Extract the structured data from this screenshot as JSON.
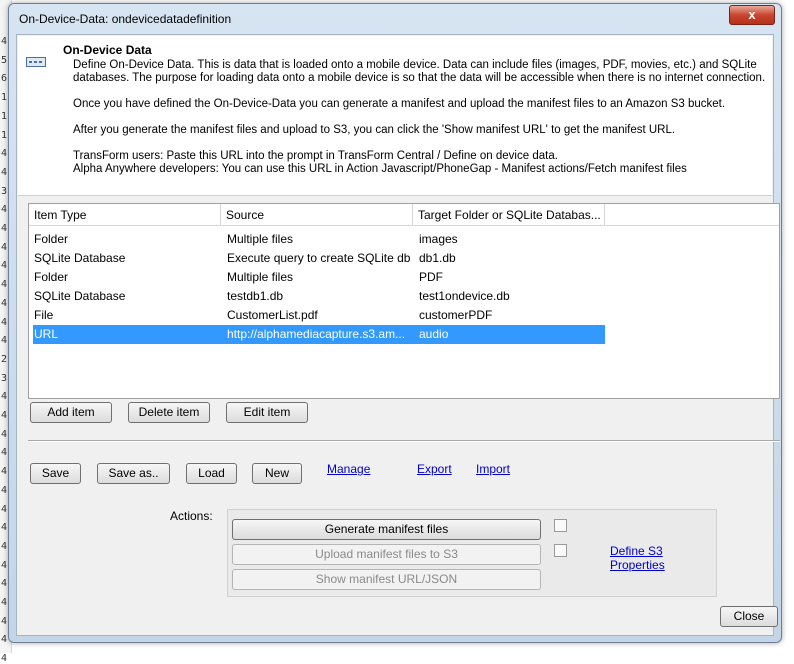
{
  "background_line_numbers": [
    "4",
    "5",
    "6",
    "1",
    "1",
    "1",
    "4",
    "4",
    "3",
    "4",
    "4",
    "4",
    "4",
    "4",
    "4",
    "4",
    "4",
    "2",
    "3",
    "4",
    "4",
    "4",
    "4",
    "4",
    "4",
    "4",
    "4",
    "4",
    "4",
    "4",
    "4",
    "4",
    "4",
    "4"
  ],
  "window": {
    "title": "On-Device-Data: ondevicedatadefinition",
    "close_glyph": "x"
  },
  "info": {
    "title": "On-Device Data",
    "paragraphs": [
      "Define On-Device Data. This is data that is loaded onto a mobile device. Data can include files (images, PDF, movies, etc.) and SQLite",
      "databases. The purpose for loading data onto a mobile device is so that the data will be accessible when there is no internet connection.",
      "Once you have defined the On-Device-Data you can generate a manifest and upload the manifest files to an Amazon S3 bucket.",
      "After you generate the manifest files and upload to S3, you can click the 'Show manifest URL' to get the manifest URL.",
      "TransForm users: Paste this URL into the prompt in TransForm Central / Define on device data.",
      "Alpha Anywhere developers: You can use this URL in Action Javascript/PhoneGap - Manifest actions/Fetch manifest files"
    ]
  },
  "grid": {
    "columns": [
      "Item Type",
      "Source",
      "Target Folder or SQLite Databas..."
    ],
    "rows": [
      {
        "type": "Folder",
        "source": "Multiple files",
        "target": "images"
      },
      {
        "type": "SQLite Database",
        "source": "Execute query to create SQLite db",
        "target": "db1.db"
      },
      {
        "type": "Folder",
        "source": "Multiple files",
        "target": "PDF"
      },
      {
        "type": "SQLite Database",
        "source": "testdb1.db",
        "target": "test1ondevice.db"
      },
      {
        "type": "File",
        "source": "CustomerList.pdf",
        "target": "customerPDF"
      },
      {
        "type": "URL",
        "source": "http://alphamediacapture.s3.am...",
        "target": "audio"
      }
    ],
    "selected_index": 5
  },
  "item_buttons": {
    "add": "Add item",
    "delete": "Delete item",
    "edit": "Edit item"
  },
  "file_buttons": {
    "save": "Save",
    "save_as": "Save as..",
    "load": "Load",
    "new": "New"
  },
  "links": {
    "manage": "Manage",
    "export": "Export",
    "import": "Import",
    "define_s3": "Define S3 Properties"
  },
  "actions": {
    "label": "Actions:",
    "generate": "Generate manifest files",
    "upload": "Upload manifest files to S3",
    "show_url": "Show manifest URL/JSON"
  },
  "footer": {
    "close": "Close"
  }
}
